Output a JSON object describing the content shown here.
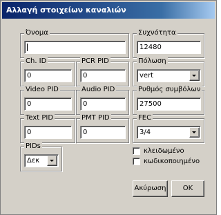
{
  "window": {
    "title": "Αλλαγή στοιχείων καναλιών"
  },
  "fields": {
    "name": {
      "label": "Όνομα",
      "value": ""
    },
    "frequency": {
      "label": "Συχνότητα",
      "value": "12480"
    },
    "ch_id": {
      "label": "Ch. ID",
      "value": "0"
    },
    "pcr_pid": {
      "label": "PCR PID",
      "value": "0"
    },
    "polarization": {
      "label": "Πόλωση",
      "value": "vert"
    },
    "video_pid": {
      "label": "Video PID",
      "value": "0"
    },
    "audio_pid": {
      "label": "Audio PID",
      "value": "0"
    },
    "symbol_rate": {
      "label": "Ρυθμός συμβόλων",
      "value": "27500"
    },
    "text_pid": {
      "label": "Text PID",
      "value": "0"
    },
    "pmt_pid": {
      "label": "PMT PID",
      "value": "0"
    },
    "fec": {
      "label": "FEC",
      "value": "3/4"
    },
    "pids": {
      "label": "PIDs",
      "value": "Δεκ"
    }
  },
  "checkboxes": [
    {
      "label": "κλειδωμένο",
      "checked": false
    },
    {
      "label": "κωδικοποιημένο",
      "checked": false
    }
  ],
  "buttons": {
    "cancel": "Ακύρωση",
    "ok": "OK"
  }
}
